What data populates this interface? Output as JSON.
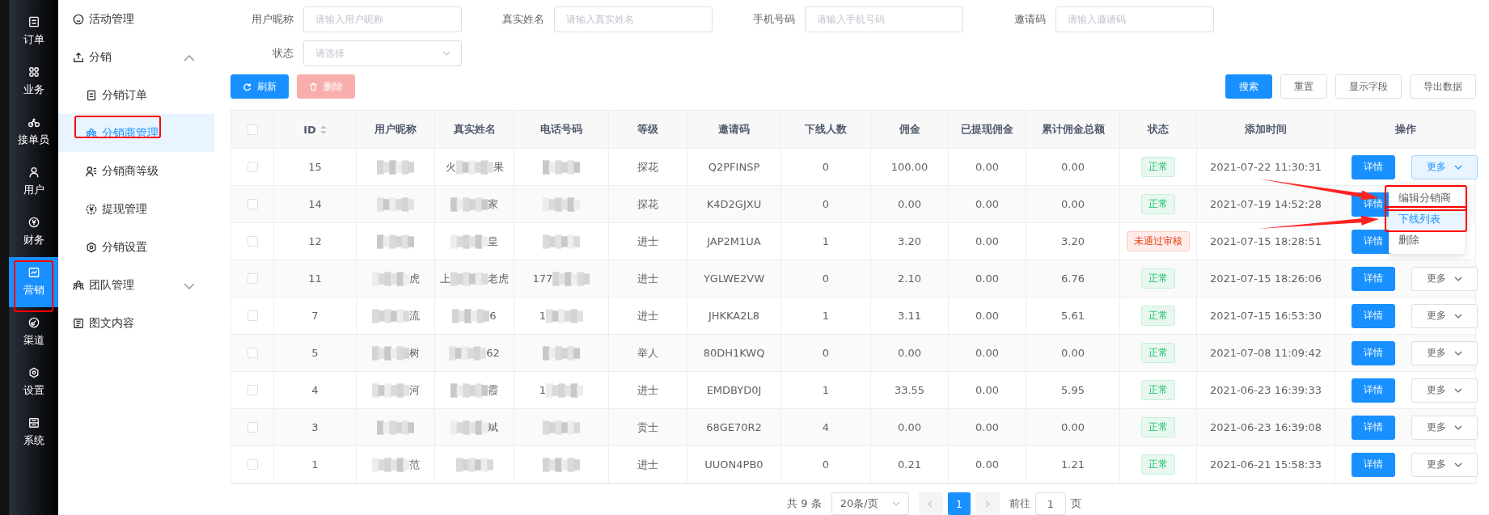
{
  "rail": [
    {
      "label": "订单",
      "selected": false
    },
    {
      "label": "业务",
      "selected": false
    },
    {
      "label": "接单员",
      "selected": false
    },
    {
      "label": "用户",
      "selected": false
    },
    {
      "label": "财务",
      "selected": false
    },
    {
      "label": "营销",
      "selected": true
    },
    {
      "label": "渠道",
      "selected": false
    },
    {
      "label": "设置",
      "selected": false
    },
    {
      "label": "系统",
      "selected": false
    }
  ],
  "menu": [
    {
      "label": "活动管理",
      "selected": false
    },
    {
      "label": "分销",
      "selected": false,
      "expanded": true,
      "children": [
        {
          "label": "分销订单",
          "selected": false
        },
        {
          "label": "分销商管理",
          "selected": true
        },
        {
          "label": "分销商等级",
          "selected": false
        },
        {
          "label": "提现管理",
          "selected": false
        },
        {
          "label": "分销设置",
          "selected": false
        }
      ]
    },
    {
      "label": "团队管理",
      "selected": false,
      "expanded": false
    },
    {
      "label": "图文内容",
      "selected": false
    }
  ],
  "filters": [
    {
      "label": "用户昵称",
      "placeholder": "请输入用户昵称",
      "kind": "text"
    },
    {
      "label": "真实姓名",
      "placeholder": "请输入真实姓名",
      "kind": "text"
    },
    {
      "label": "手机号码",
      "placeholder": "请输入手机号码",
      "kind": "text"
    },
    {
      "label": "邀请码",
      "placeholder": "请输入邀请码",
      "kind": "text"
    },
    {
      "label": "状态",
      "placeholder": "请选择",
      "kind": "select"
    }
  ],
  "toolbar_left": [
    {
      "label": "刷新",
      "kind": "primary",
      "disabled": false
    },
    {
      "label": "删除",
      "kind": "danger",
      "disabled": true
    }
  ],
  "toolbar_right": [
    {
      "label": "搜索",
      "kind": "primary"
    },
    {
      "label": "重置",
      "kind": "default"
    },
    {
      "label": "显示字段",
      "kind": "default"
    },
    {
      "label": "导出数据",
      "kind": "default"
    }
  ],
  "table": {
    "all_checked": false,
    "columns": [
      "ID",
      "用户昵称",
      "真实姓名",
      "电话号码",
      "等级",
      "邀请码",
      "下线人数",
      "佣金",
      "已提现佣金",
      "累计佣金总额",
      "状态",
      "添加时间",
      "操作"
    ],
    "rows": [
      {
        "checked": false,
        "id": "15",
        "nick": {},
        "real_name": {
          "before": "火",
          "after": "果"
        },
        "phone": {},
        "level": "探花",
        "invite": "Q2PFINSP",
        "downline": "0",
        "commission": "100.00",
        "withdrawn": "0.00",
        "total": "0.00",
        "status": {
          "label": "正常",
          "kind": "ok"
        },
        "added": "2021-07-22 11:30:31",
        "actions": [
          {
            "label": "详情",
            "kind": "primary"
          },
          {
            "label": "更多",
            "kind": "dropdown",
            "open": true
          }
        ]
      },
      {
        "checked": false,
        "id": "14",
        "nick": {},
        "real_name": {
          "after": "家"
        },
        "phone": {},
        "level": "探花",
        "invite": "K4D2GJXU",
        "downline": "0",
        "commission": "0.00",
        "withdrawn": "0.00",
        "total": "0.00",
        "status": {
          "label": "正常",
          "kind": "ok"
        },
        "added": "2021-07-19 14:52:28",
        "actions": [
          {
            "label": "详情",
            "kind": "primary"
          }
        ]
      },
      {
        "checked": false,
        "id": "12",
        "nick": {},
        "real_name": {
          "after": "皇"
        },
        "phone": {},
        "level": "进士",
        "invite": "JAP2M1UA",
        "downline": "1",
        "commission": "3.20",
        "withdrawn": "0.00",
        "total": "3.20",
        "status": {
          "label": "未通过审核",
          "kind": "rejected"
        },
        "added": "2021-07-15 18:28:51",
        "actions": [
          {
            "label": "详情",
            "kind": "primary"
          }
        ]
      },
      {
        "checked": false,
        "id": "11",
        "nick": {
          "after": "虎"
        },
        "real_name": {
          "before": "上",
          "after": "老虎"
        },
        "phone": {
          "before": "177"
        },
        "level": "进士",
        "invite": "YGLWE2VW",
        "downline": "0",
        "commission": "2.10",
        "withdrawn": "0.00",
        "total": "6.76",
        "status": {
          "label": "正常",
          "kind": "ok"
        },
        "added": "2021-07-15 18:26:06",
        "actions": [
          {
            "label": "详情",
            "kind": "primary"
          },
          {
            "label": "更多",
            "kind": "dropdown",
            "open": false
          }
        ]
      },
      {
        "checked": false,
        "id": "7",
        "nick": {
          "after": "流"
        },
        "real_name": {
          "after": "6"
        },
        "phone": {
          "before": "1"
        },
        "level": "进士",
        "invite": "JHKKA2L8",
        "downline": "1",
        "commission": "3.11",
        "withdrawn": "0.00",
        "total": "5.61",
        "status": {
          "label": "正常",
          "kind": "ok"
        },
        "added": "2021-07-15 16:53:30",
        "actions": [
          {
            "label": "详情",
            "kind": "primary"
          },
          {
            "label": "更多",
            "kind": "dropdown",
            "open": false
          }
        ]
      },
      {
        "checked": false,
        "id": "5",
        "nick": {
          "after": "树"
        },
        "real_name": {
          "after": "62"
        },
        "phone": {},
        "level": "举人",
        "invite": "80DH1KWQ",
        "downline": "0",
        "commission": "0.00",
        "withdrawn": "0.00",
        "total": "0.00",
        "status": {
          "label": "正常",
          "kind": "ok"
        },
        "added": "2021-07-08 11:09:42",
        "actions": [
          {
            "label": "详情",
            "kind": "primary"
          },
          {
            "label": "更多",
            "kind": "dropdown",
            "open": false
          }
        ]
      },
      {
        "checked": false,
        "id": "4",
        "nick": {
          "after": "河"
        },
        "real_name": {
          "after": "霞"
        },
        "phone": {
          "before": "1"
        },
        "level": "进士",
        "invite": "EMDBYD0J",
        "downline": "1",
        "commission": "33.55",
        "withdrawn": "0.00",
        "total": "5.95",
        "status": {
          "label": "正常",
          "kind": "ok"
        },
        "added": "2021-06-23 16:39:33",
        "actions": [
          {
            "label": "详情",
            "kind": "primary"
          },
          {
            "label": "更多",
            "kind": "dropdown",
            "open": false
          }
        ]
      },
      {
        "checked": false,
        "id": "3",
        "nick": {},
        "real_name": {
          "after": "斌"
        },
        "phone": {},
        "level": "贡士",
        "invite": "68GE70R2",
        "downline": "4",
        "commission": "0.00",
        "withdrawn": "0.00",
        "total": "0.00",
        "status": {
          "label": "正常",
          "kind": "ok"
        },
        "added": "2021-06-23 16:39:08",
        "actions": [
          {
            "label": "详情",
            "kind": "primary"
          },
          {
            "label": "更多",
            "kind": "dropdown",
            "open": false
          }
        ]
      },
      {
        "checked": false,
        "id": "1",
        "nick": {
          "after": "范"
        },
        "real_name": {},
        "phone": {},
        "level": "进士",
        "invite": "UUON4PB0",
        "downline": "0",
        "commission": "0.21",
        "withdrawn": "0.00",
        "total": "1.21",
        "status": {
          "label": "正常",
          "kind": "ok"
        },
        "added": "2021-06-21 15:58:33",
        "actions": [
          {
            "label": "详情",
            "kind": "primary"
          },
          {
            "label": "更多",
            "kind": "dropdown",
            "open": false
          }
        ]
      }
    ]
  },
  "dropdown": [
    {
      "label": "编辑分销商",
      "selected": false
    },
    {
      "label": "下线列表",
      "selected": true
    },
    {
      "label": "删除",
      "selected": false
    }
  ],
  "pagination": {
    "total": "共 9 条",
    "page_size": "20条/页",
    "pages": [
      {
        "label": "1",
        "selected": true
      }
    ],
    "goto_label": "前往",
    "goto_value": "1",
    "goto_suffix": "页"
  },
  "annotations": [
    {
      "kind": "box"
    },
    {
      "kind": "box"
    },
    {
      "kind": "box"
    },
    {
      "kind": "box"
    },
    {
      "kind": "arrow"
    },
    {
      "kind": "arrow"
    }
  ]
}
